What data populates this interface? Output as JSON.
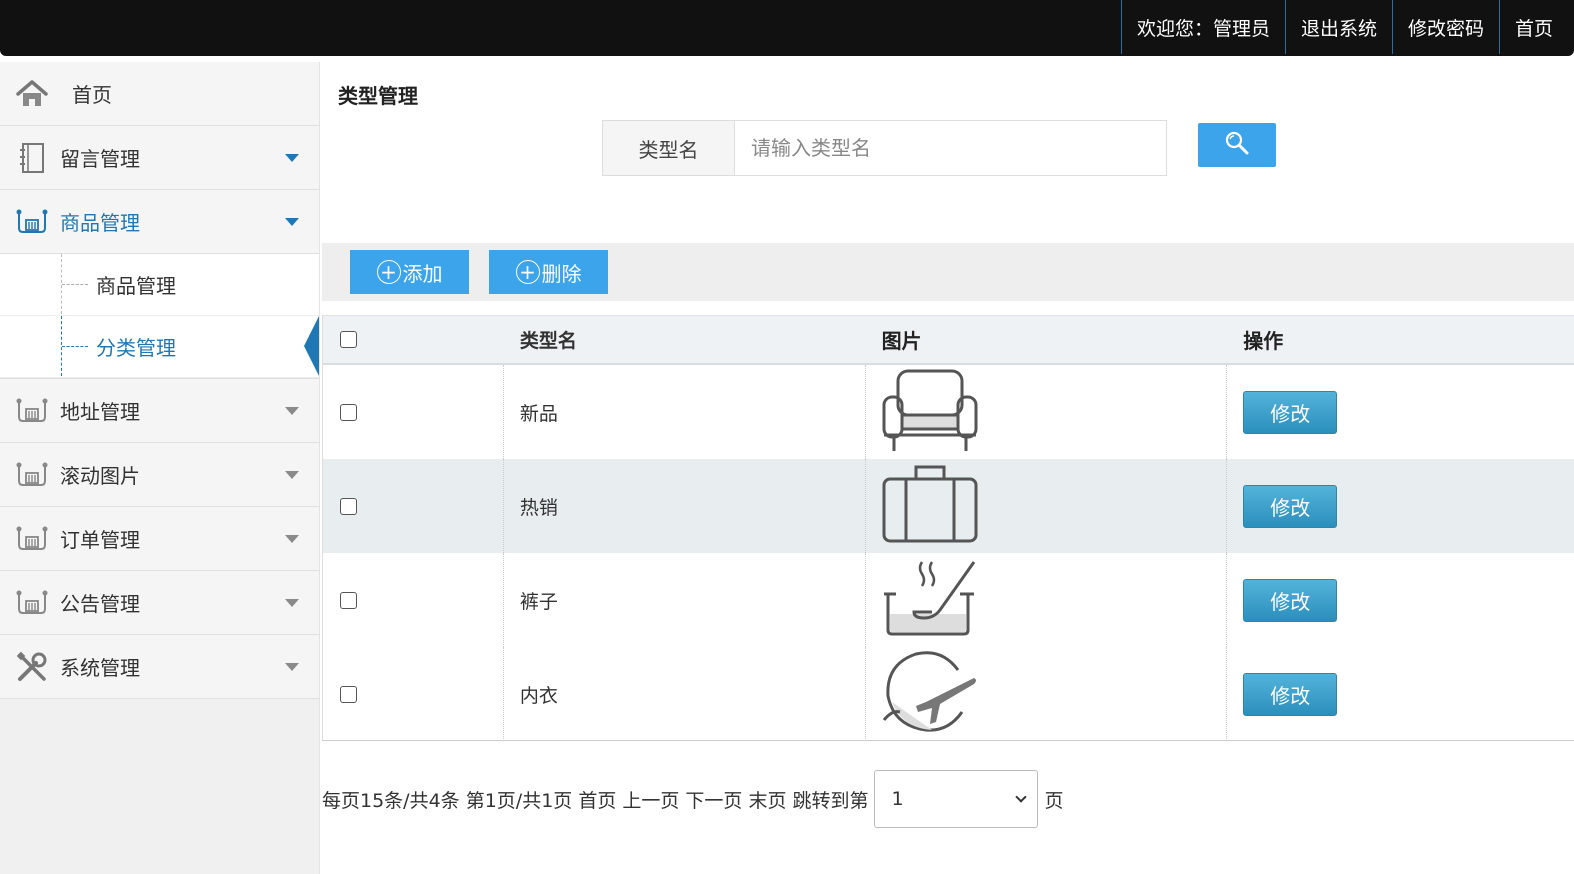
{
  "topnav": {
    "welcome": "欢迎您：管理员",
    "logout": "退出系统",
    "change_password": "修改密码",
    "home": "首页"
  },
  "sidebar": {
    "home": "首页",
    "items": [
      {
        "label": "留言管理",
        "icon": "notebook-icon"
      },
      {
        "label": "商品管理",
        "icon": "tools-rack-icon"
      },
      {
        "label": "地址管理",
        "icon": "tools-rack-icon"
      },
      {
        "label": "滚动图片",
        "icon": "tools-rack-icon"
      },
      {
        "label": "订单管理",
        "icon": "tools-rack-icon"
      },
      {
        "label": "公告管理",
        "icon": "tools-rack-icon"
      },
      {
        "label": "系统管理",
        "icon": "wrench-screwdriver-icon"
      }
    ],
    "submenu": [
      "商品管理",
      "分类管理"
    ]
  },
  "main": {
    "title": "类型管理",
    "search": {
      "label": "类型名",
      "placeholder": "请输入类型名"
    },
    "toolbar": {
      "add": "添加",
      "delete": "删除"
    },
    "table": {
      "headers": [
        "类型名",
        "图片",
        "操作"
      ],
      "rows": [
        {
          "name": "新品",
          "image": "armchair-icon",
          "action": "修改"
        },
        {
          "name": "热销",
          "image": "suitcase-icon",
          "action": "修改"
        },
        {
          "name": "裤子",
          "image": "soup-pot-icon",
          "action": "修改"
        },
        {
          "name": "内衣",
          "image": "airplane-globe-icon",
          "action": "修改"
        }
      ]
    },
    "pager": {
      "text": "每页15条/共4条 第1页/共1页 首页 上一页 下一页 末页 跳转到第",
      "selected_page": "1",
      "suffix": "页"
    }
  },
  "colors": {
    "accent": "#3ba4ea",
    "active_menu": "#1f78b4",
    "topbar": "#111111"
  }
}
